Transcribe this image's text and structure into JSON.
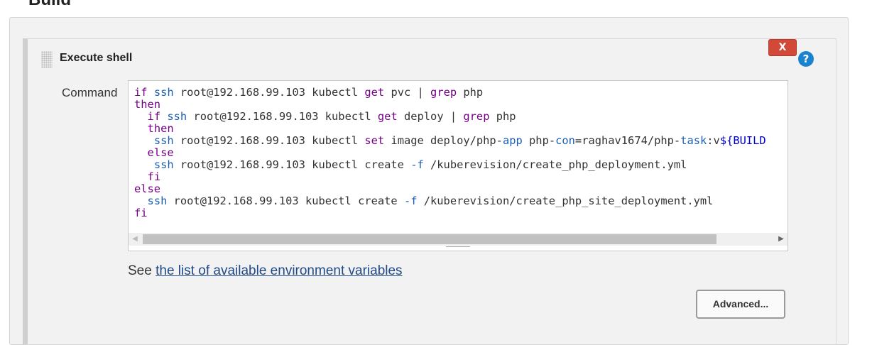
{
  "section": {
    "title": "Build"
  },
  "step": {
    "title": "Execute shell",
    "delete_label": "X",
    "help_label": "?",
    "command_label": "Command",
    "command_lines": [
      [
        {
          "t": "if",
          "c": "kw"
        },
        {
          "t": " "
        },
        {
          "t": "ssh",
          "c": "cm"
        },
        {
          "t": " root@192.168.99.103 kubectl "
        },
        {
          "t": "get",
          "c": "kw"
        },
        {
          "t": " pvc | "
        },
        {
          "t": "grep",
          "c": "kw"
        },
        {
          "t": " php"
        }
      ],
      [
        {
          "t": "then",
          "c": "kw"
        }
      ],
      [
        {
          "t": "  "
        },
        {
          "t": "if",
          "c": "kw"
        },
        {
          "t": " "
        },
        {
          "t": "ssh",
          "c": "cm"
        },
        {
          "t": " root@192.168.99.103 kubectl "
        },
        {
          "t": "get",
          "c": "kw"
        },
        {
          "t": " deploy | "
        },
        {
          "t": "grep",
          "c": "kw"
        },
        {
          "t": " php"
        }
      ],
      [
        {
          "t": "  "
        },
        {
          "t": "then",
          "c": "kw"
        }
      ],
      [
        {
          "t": "   "
        },
        {
          "t": "ssh",
          "c": "cm"
        },
        {
          "t": " root@192.168.99.103 kubectl "
        },
        {
          "t": "set",
          "c": "kw"
        },
        {
          "t": " image deploy/php-"
        },
        {
          "t": "app",
          "c": "cm"
        },
        {
          "t": " php-"
        },
        {
          "t": "con",
          "c": "cm"
        },
        {
          "t": "=raghav1674/php-"
        },
        {
          "t": "task",
          "c": "cm"
        },
        {
          "t": ":v"
        },
        {
          "t": "${BUILD",
          "c": "vr"
        }
      ],
      [
        {
          "t": "  "
        },
        {
          "t": "else",
          "c": "kw"
        }
      ],
      [
        {
          "t": "   "
        },
        {
          "t": "ssh",
          "c": "cm"
        },
        {
          "t": " root@192.168.99.103 kubectl create "
        },
        {
          "t": "-f",
          "c": "cm"
        },
        {
          "t": " /kuberevision/create_php_deployment.yml"
        }
      ],
      [
        {
          "t": "  "
        },
        {
          "t": "fi",
          "c": "kw"
        }
      ],
      [
        {
          "t": "else",
          "c": "kw"
        }
      ],
      [
        {
          "t": "  "
        },
        {
          "t": "ssh",
          "c": "cm"
        },
        {
          "t": " root@192.168.99.103 kubectl create "
        },
        {
          "t": "-f",
          "c": "cm"
        },
        {
          "t": " /kuberevision/create_php_site_deployment.yml"
        }
      ],
      [
        {
          "t": "fi",
          "c": "kw"
        }
      ]
    ],
    "see_prefix": "See ",
    "env_link": "the list of available environment variables",
    "advanced_label": "Advanced..."
  },
  "scrollbar": {
    "left_arrow": "◀",
    "right_arrow": "▶"
  },
  "colors": {
    "keyword": "#770088",
    "command": "#1a5fb4",
    "variable": "#0000cc",
    "delete": "#d24939",
    "help": "#1a83d0",
    "link": "#204a87"
  }
}
